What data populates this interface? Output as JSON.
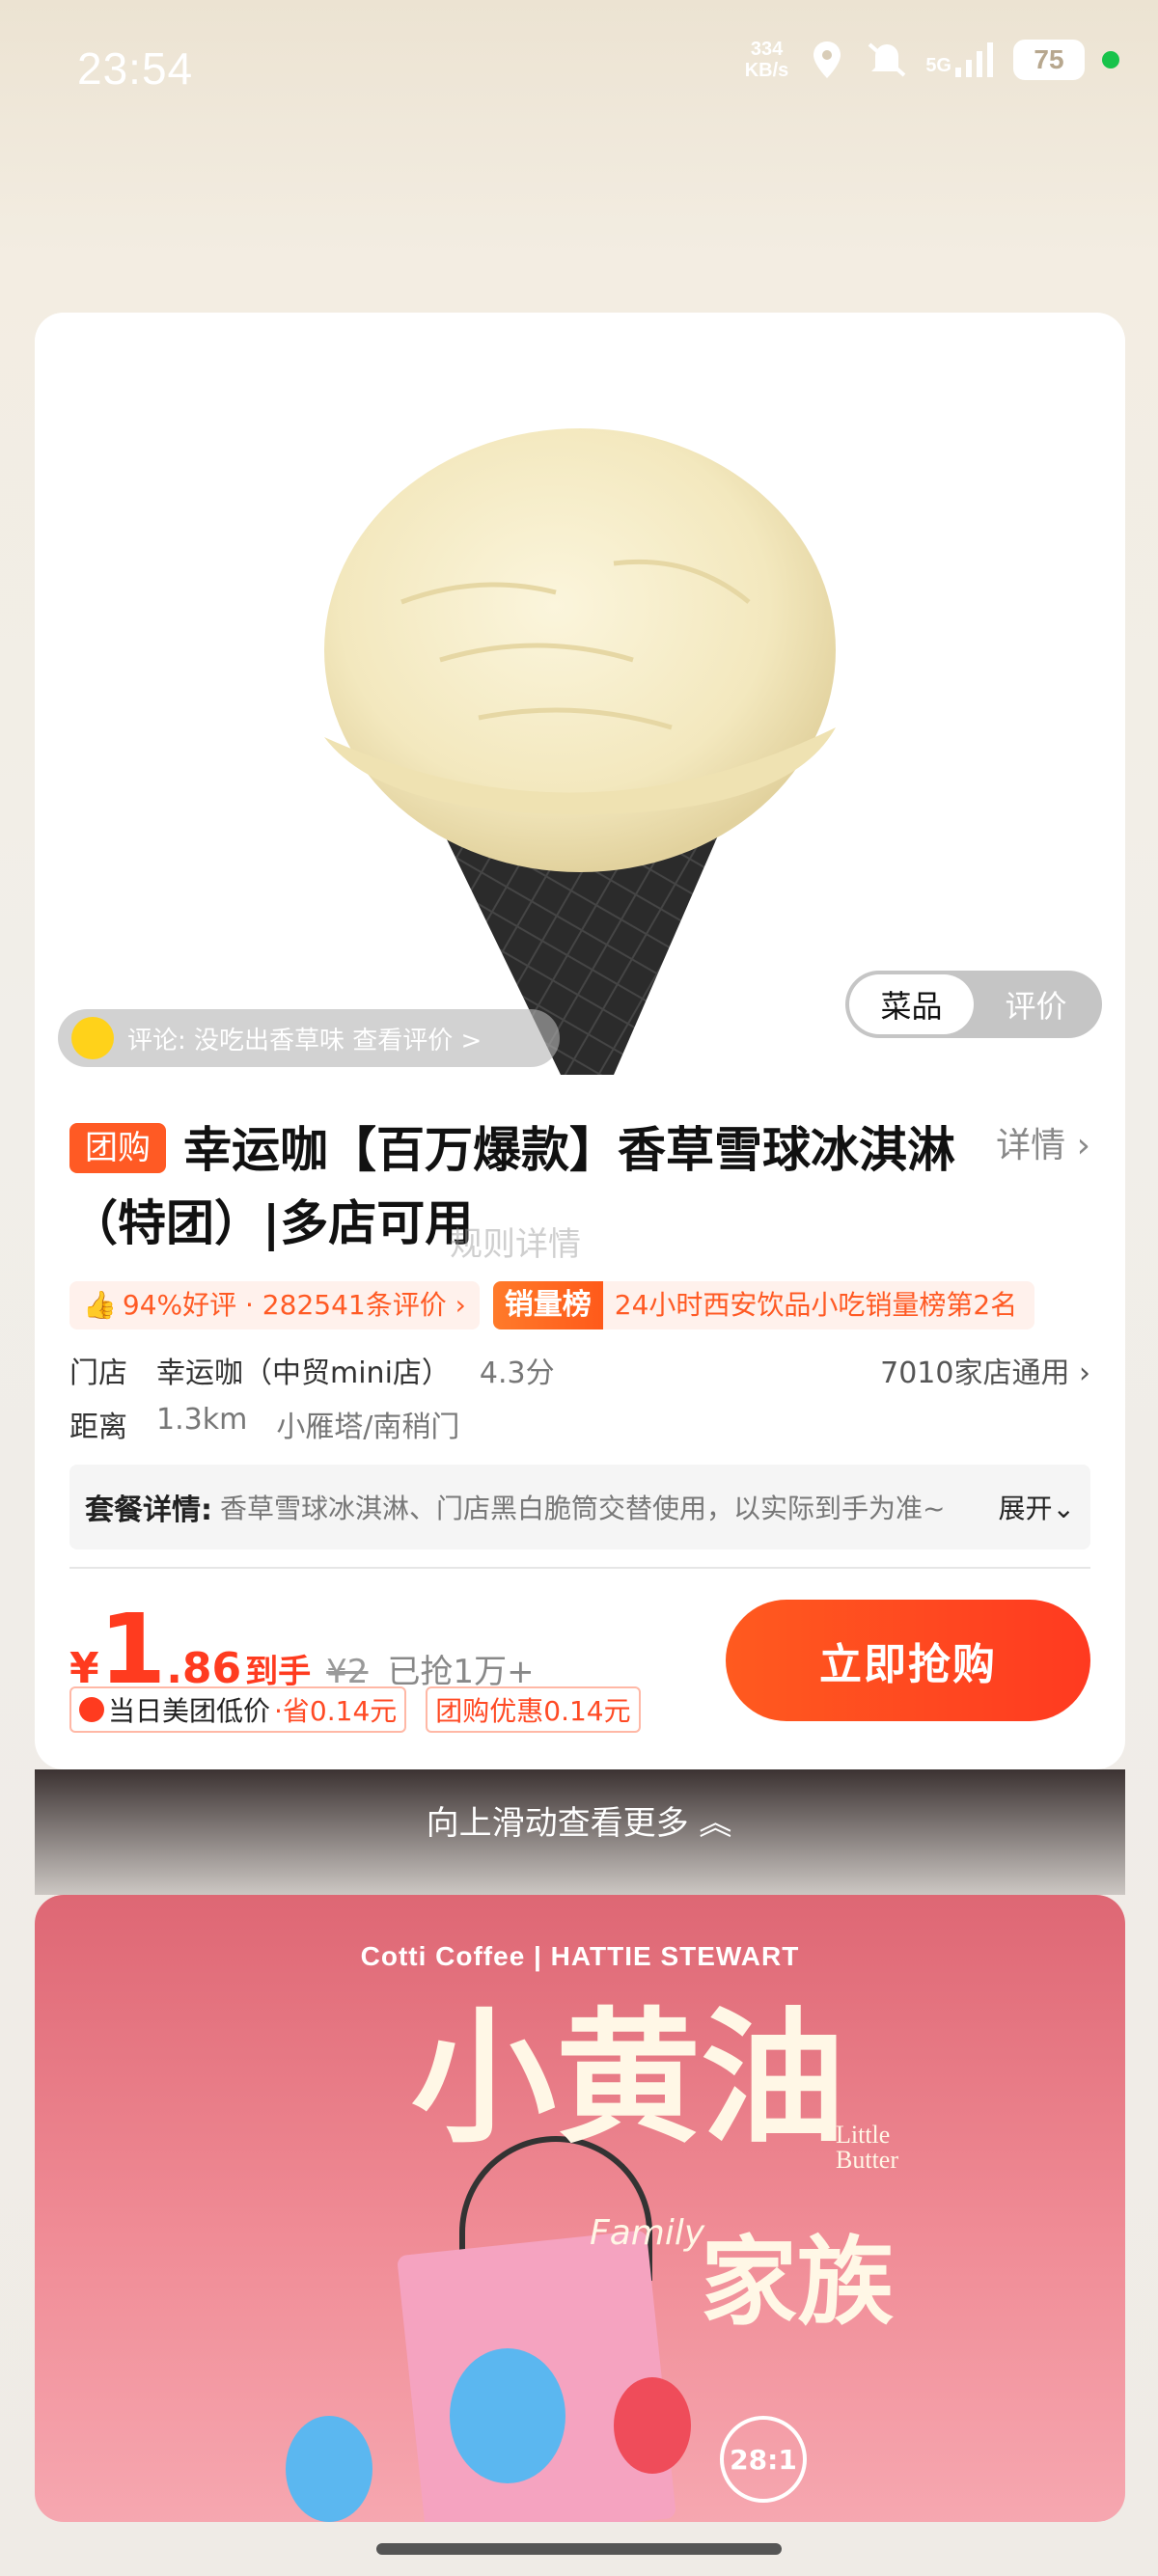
{
  "status_bar": {
    "time": "23:54",
    "net_speed_value": "334",
    "net_speed_unit": "KB/s",
    "network_type": "5G",
    "battery": "75"
  },
  "product": {
    "review_snippet": "评论: 没吃出香草味 查看评价 >",
    "toggle": {
      "dishes": "菜品",
      "reviews": "评价"
    },
    "tag": "团购",
    "title": "幸运咖【百万爆款】香草雪球冰淇淋（特团）|多店可用",
    "detail_link": "详情 ›",
    "title_overlay": "规则详情",
    "rating_badge": "94%好评 · 282541条评价 ›",
    "sales_label": "销量榜",
    "sales_text": "24小时西安饮品小吃销量榜第2名",
    "store_label": "门店",
    "store_name": "幸运咖（中贸mini店）",
    "store_score": "4.3分",
    "store_count": "7010家店通用 ›",
    "distance_label": "距离",
    "distance": "1.3km",
    "area": "小雁塔/南稍门",
    "package_label": "套餐详情:",
    "package_text": "香草雪球冰淇淋、门店黑白脆筒交替使用，以实际到手为准~",
    "package_expand": "展开⌄",
    "price_yen": "¥",
    "price_int": "1",
    "price_dec": ".86",
    "price_suffix": "到手",
    "orig_price": "¥2",
    "sold": "已抢1万+",
    "discount1_a": "当日美团低价",
    "discount1_b": "·省0.14元",
    "discount2": "团购优惠0.14元",
    "buy_button": "立即抢购"
  },
  "swipe_hint": "向上滑动查看更多 ︽",
  "promo": {
    "brand": "Cotti Coffee  |  HATTIE STEWART",
    "title_line1": "小黄油",
    "sub_line1": "Little",
    "sub_line2": "Butter",
    "family": "Family",
    "title_line2": "家族",
    "badge": "28:1"
  }
}
